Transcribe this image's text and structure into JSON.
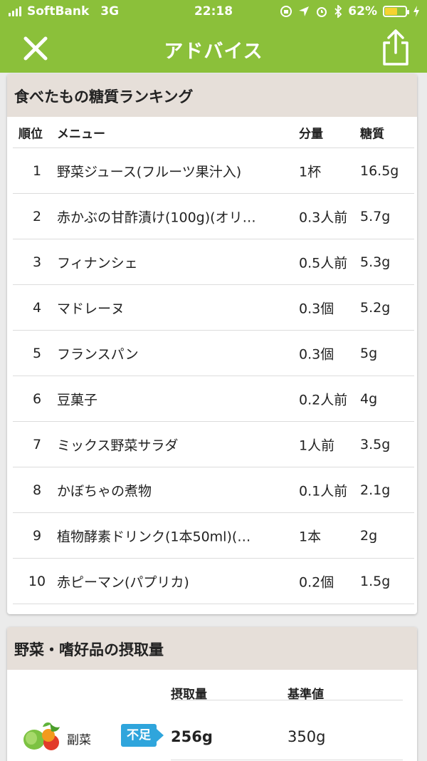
{
  "status_bar": {
    "carrier": "SoftBank",
    "network": "3G",
    "time": "22:18",
    "battery": "62%",
    "battery_level": 0.62
  },
  "nav": {
    "title": "アドバイス",
    "close_icon": "close-icon",
    "share_icon": "share-icon"
  },
  "ranking": {
    "title": "食べたもの糖質ランキング",
    "headers": {
      "rank": "順位",
      "menu": "メニュー",
      "amount": "分量",
      "sugar": "糖質"
    },
    "rows": [
      {
        "rank": "1",
        "menu": "野菜ジュース(フルーツ果汁入)",
        "amount": "1杯",
        "sugar": "16.5g"
      },
      {
        "rank": "2",
        "menu": "赤かぶの甘酢漬け(100g)(オリ…",
        "amount": "0.3人前",
        "sugar": "5.7g"
      },
      {
        "rank": "3",
        "menu": "フィナンシェ",
        "amount": "0.5人前",
        "sugar": "5.3g"
      },
      {
        "rank": "4",
        "menu": "マドレーヌ",
        "amount": "0.3個",
        "sugar": "5.2g"
      },
      {
        "rank": "5",
        "menu": "フランスパン",
        "amount": "0.3個",
        "sugar": "5g"
      },
      {
        "rank": "6",
        "menu": "豆菓子",
        "amount": "0.2人前",
        "sugar": "4g"
      },
      {
        "rank": "7",
        "menu": "ミックス野菜サラダ",
        "amount": "1人前",
        "sugar": "3.5g"
      },
      {
        "rank": "8",
        "menu": "かぼちゃの煮物",
        "amount": "0.1人前",
        "sugar": "2.1g"
      },
      {
        "rank": "9",
        "menu": "植物酵素ドリンク(1本50ml)(…",
        "amount": "1本",
        "sugar": "2g"
      },
      {
        "rank": "10",
        "menu": "赤ピーマン(パプリカ)",
        "amount": "0.2個",
        "sugar": "1.5g"
      }
    ]
  },
  "intake": {
    "title": "野菜・嗜好品の摂取量",
    "headers": {
      "intake": "摂取量",
      "reference": "基準値"
    },
    "rows": [
      {
        "icon": "vegetable-icon",
        "label": "副菜",
        "badge": "不足",
        "intake": "256g",
        "reference": "350g"
      }
    ]
  },
  "colors": {
    "header_green": "#8bc03a",
    "section_bg": "#e6dfd9",
    "badge_blue": "#2fa5dc"
  }
}
